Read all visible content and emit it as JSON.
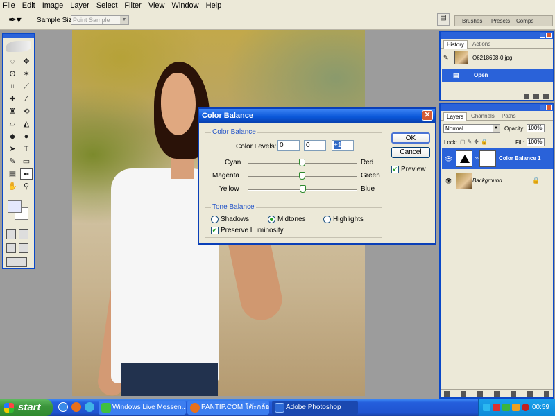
{
  "menubar": {
    "items": [
      "File",
      "Edit",
      "Image",
      "Layer",
      "Select",
      "Filter",
      "View",
      "Window",
      "Help"
    ]
  },
  "options_bar": {
    "tool_icon": "eyedropper-icon",
    "sample_size_label": "Sample Size:",
    "sample_size_value": "Point Sample",
    "wells": [
      "Brushes",
      "Presets",
      "Comps"
    ]
  },
  "history_panel": {
    "tabs": [
      "History",
      "Actions"
    ],
    "snapshot_name": "O6218698-0.jpg",
    "states": [
      "Open"
    ]
  },
  "layers_panel": {
    "tabs": [
      "Layers",
      "Channels",
      "Paths"
    ],
    "blend_mode": "Normal",
    "opacity_label": "Opacity:",
    "opacity_value": "100%",
    "lock_label": "Lock:",
    "fill_label": "Fill:",
    "fill_value": "100%",
    "layers": [
      {
        "name": "Color Balance 1",
        "selected": true
      },
      {
        "name": "Background",
        "selected": false
      }
    ]
  },
  "dialog": {
    "title": "Color Balance",
    "color_balance_group": "Color Balance",
    "color_levels_label": "Color Levels:",
    "levels": [
      "0",
      "0",
      "+1"
    ],
    "sliders": [
      {
        "left": "Cyan",
        "right": "Red",
        "value": 0
      },
      {
        "left": "Magenta",
        "right": "Green",
        "value": 0
      },
      {
        "left": "Yellow",
        "right": "Blue",
        "value": 1
      }
    ],
    "tone_balance_group": "Tone Balance",
    "tones": [
      "Shadows",
      "Midtones",
      "Highlights"
    ],
    "selected_tone": "Midtones",
    "preserve_luminosity": "Preserve Luminosity",
    "ok": "OK",
    "cancel": "Cancel",
    "preview": "Preview"
  },
  "taskbar": {
    "start": "start",
    "tasks": [
      "Windows Live Messen...",
      "PANTIP.COM โต๊ะกล้อ...",
      "Adobe Photoshop"
    ],
    "clock": "00:59"
  },
  "colors": {
    "xp_blue": "#2a62d9",
    "dialog_accent": "#2052c8",
    "taskbar_green": "#3c963c"
  }
}
